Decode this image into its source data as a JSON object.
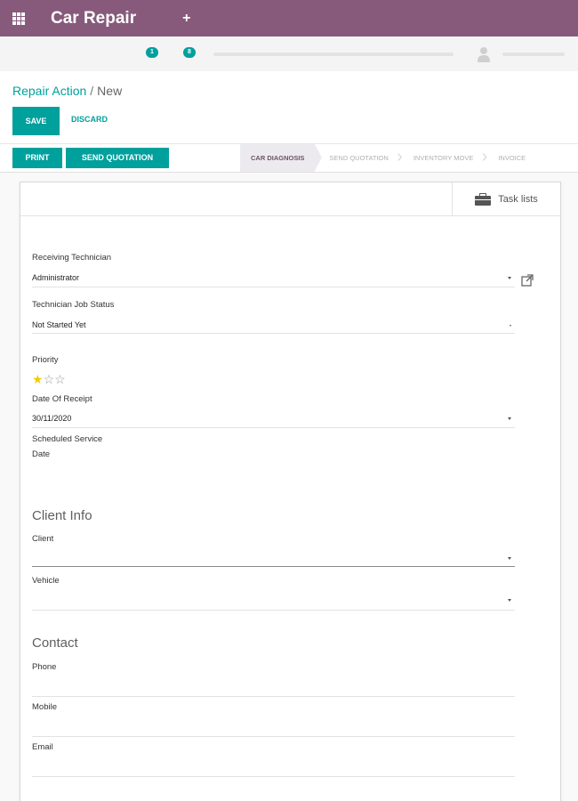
{
  "navbar": {
    "app_title": "Car Repair",
    "apps_icon": "apps-grid-icon",
    "new_icon": "plus-icon",
    "accent_color": "#875a7b"
  },
  "systray": {
    "badge_1": "1",
    "badge_2": "8"
  },
  "breadcrumb": {
    "parent": "Repair Action",
    "separator": "/",
    "current": "New"
  },
  "form_actions": {
    "save_label": "SAVE",
    "discard_label": "DISCARD",
    "primary_color": "#00a09d"
  },
  "header_buttons": {
    "print_label": "PRINT",
    "send_quotation_label": "SEND QUOTATION"
  },
  "stages": [
    {
      "label": "CAR DIAGNOSIS",
      "active": true
    },
    {
      "label": "SEND QUOTATION",
      "active": false
    },
    {
      "label": "INVENTORY MOVE",
      "active": false
    },
    {
      "label": "INVOICE",
      "active": false
    }
  ],
  "smart_buttons": {
    "task_lists_label": "Task lists"
  },
  "fields": {
    "receiving_technician": {
      "label": "Receiving Technician",
      "value": "Administrator"
    },
    "technician_job_status": {
      "label": "Technician Job Status",
      "value": "Not Started Yet"
    },
    "priority": {
      "label": "Priority",
      "stars_total": 3,
      "stars_filled": 1
    },
    "date_of_receipt": {
      "label": "Date Of Receipt",
      "value": "30/11/2020"
    },
    "scheduled_service_date": {
      "label_line1": "Scheduled Service",
      "label_line2": "Date",
      "value": ""
    }
  },
  "client_info": {
    "section_title": "Client Info",
    "client_label": "Client",
    "client_value": "",
    "vehicle_label": "Vehicle",
    "vehicle_value": ""
  },
  "contact": {
    "section_title": "Contact",
    "phone_label": "Phone",
    "mobile_label": "Mobile",
    "email_label": "Email"
  }
}
